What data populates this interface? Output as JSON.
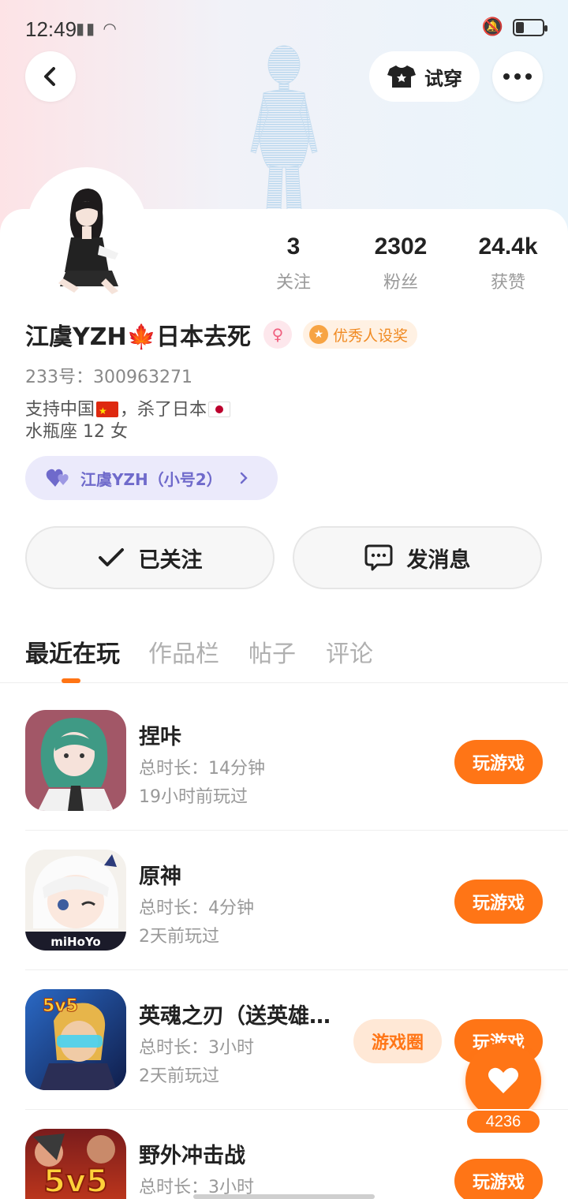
{
  "status_bar": {
    "time": "12:49"
  },
  "header": {
    "try_on_label": "试穿"
  },
  "profile": {
    "stats": [
      {
        "value": "3",
        "label": "关注"
      },
      {
        "value": "2302",
        "label": "粉丝"
      },
      {
        "value": "24.4k",
        "label": "获赞"
      }
    ],
    "name_part1": "江虞YZH",
    "name_part2": "日本去死",
    "honor_badge": "优秀人设奖",
    "id_line": "233号：300963271",
    "bio_line1_a": "支持中国",
    "bio_line1_b": "，杀了日本",
    "bio_line2": "水瓶座 12 女",
    "alt_account": "江虞YZH（小号2）",
    "follow_label": "已关注",
    "message_label": "发消息"
  },
  "tabs": [
    "最近在玩",
    "作品栏",
    "帖子",
    "评论"
  ],
  "games": [
    {
      "title": "捏咔",
      "duration": "总时长：14分钟",
      "last_played": "19小时前玩过",
      "play_label": "玩游戏"
    },
    {
      "title": "原神",
      "duration": "总时长：4分钟",
      "last_played": "2天前玩过",
      "play_label": "玩游戏",
      "icon_text": "miHoYo"
    },
    {
      "title": "英魂之刃（送英雄…",
      "duration": "总时长：3小时",
      "last_played": "2天前玩过",
      "play_label": "玩游戏",
      "circle_label": "游戏圈",
      "icon_text": "5v5"
    },
    {
      "title": "野外冲击战",
      "duration": "总时长：3小时",
      "play_label": "玩游戏",
      "icon_text": "5v5"
    }
  ],
  "like_count": "4236",
  "colors": {
    "accent": "#ff7516",
    "alt_account_bg": "#ebeafb",
    "alt_account_text": "#6f6acb"
  }
}
